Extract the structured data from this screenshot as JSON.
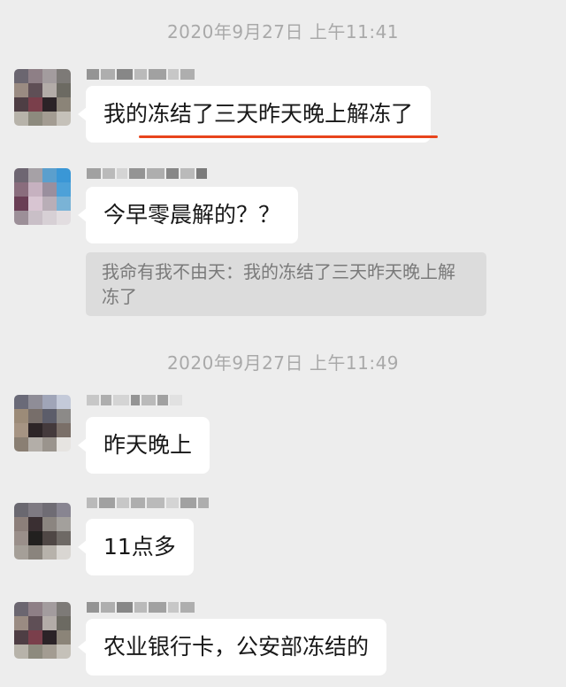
{
  "timestamps": [
    "2020年9月27日 上午11:41",
    "2020年9月27日 上午11:49"
  ],
  "messages": [
    {
      "text": "我的冻结了三天昨天晚上解冻了"
    },
    {
      "text": "今早零晨解的？？",
      "quote": "我命有我不由天：我的冻结了三天昨天晚上解冻了"
    },
    {
      "text": "昨天晚上"
    },
    {
      "text": "11点多"
    },
    {
      "text": "农业银行卡，公安部冻结的"
    }
  ],
  "colors": {
    "background": "#ededed",
    "bubble": "#ffffff",
    "quote_background": "#dcdcdc",
    "annotation_underline": "#e8441c",
    "timestamp_text": "#a9a9a9"
  }
}
